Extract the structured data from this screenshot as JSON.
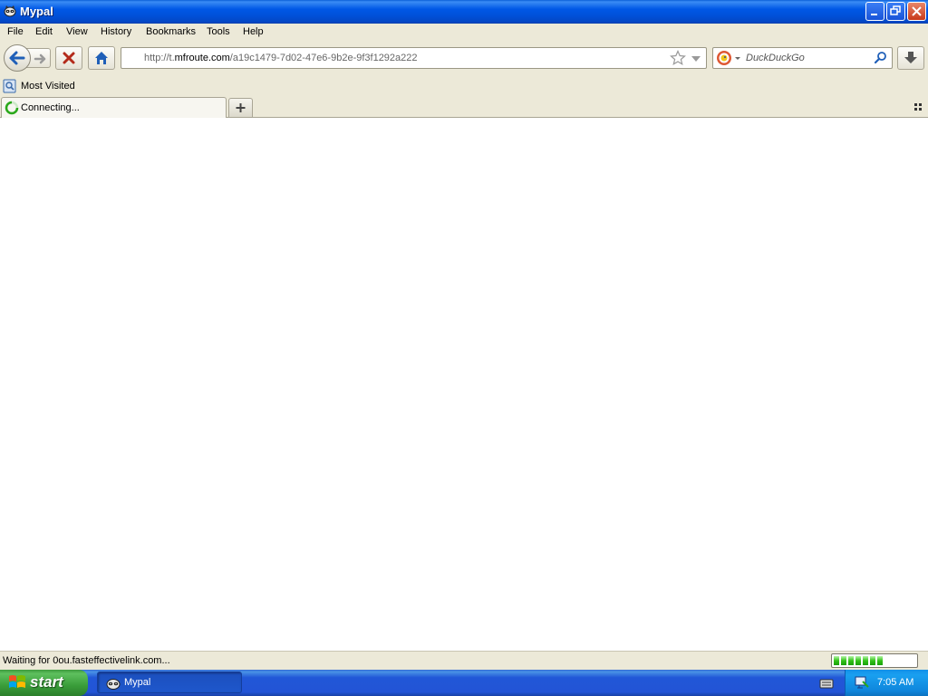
{
  "window": {
    "title": "Mypal",
    "icon": "mypal-raccoon-icon"
  },
  "menu": {
    "items": [
      "File",
      "Edit",
      "View",
      "History",
      "Bookmarks",
      "Tools",
      "Help"
    ]
  },
  "navigation": {
    "url_prefix": "http://t.",
    "url_domain": "mfroute.com",
    "url_path": "/a19c1479-7d02-47e6-9b2e-9f3f1292a222",
    "search_placeholder": "DuckDuckGo",
    "search_engine_icon": "duckduckgo-icon"
  },
  "bookmarks": {
    "items": [
      {
        "label": "Most Visited",
        "icon": "most-visited-icon"
      }
    ]
  },
  "tabs": {
    "items": [
      {
        "label": "Connecting...",
        "loading": true
      }
    ],
    "new_tab_label": "+"
  },
  "status": {
    "text": "Waiting for 0ou.fasteffectivelink.com...",
    "progress_segments": 7,
    "progress_total_segments": 11
  },
  "taskbar": {
    "start_label": "start",
    "task_items": [
      {
        "label": "Mypal",
        "icon": "mypal-raccoon-icon"
      }
    ],
    "clock": "7:05 AM"
  },
  "colors": {
    "titlebar": "#0058e6",
    "chrome": "#ece9d8",
    "start_button": "#3a9d3a",
    "tray": "#0f86dc"
  }
}
